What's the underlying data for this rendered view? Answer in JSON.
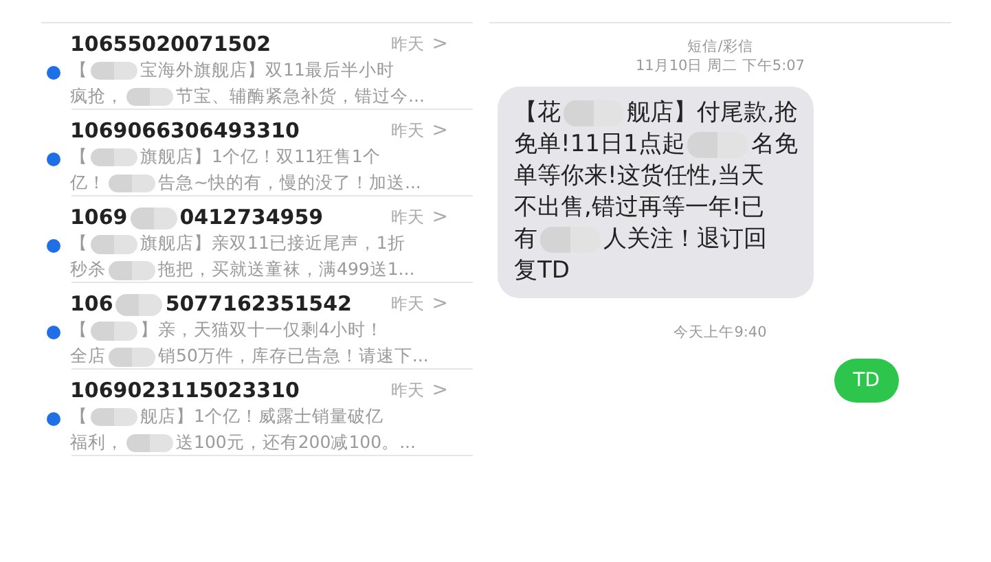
{
  "message_list": [
    {
      "sender": [
        "10655020071502"
      ],
      "time": "昨天",
      "chevron": ">",
      "unread": true,
      "preview": [
        [
          "【",
          "宝海外旗舰店】双11最后半小时"
        ],
        [
          "疯抢，",
          "节宝、辅酶紧急补货，错过今..."
        ]
      ]
    },
    {
      "sender": [
        "1069066306493310"
      ],
      "time": "昨天",
      "chevron": ">",
      "unread": true,
      "preview": [
        [
          "【",
          "旗舰店】1个亿！双11狂售1个"
        ],
        [
          "亿！",
          "告急~快的有，慢的没了！加送..."
        ]
      ]
    },
    {
      "sender": [
        "1069",
        "0412734959"
      ],
      "time": "昨天",
      "chevron": ">",
      "unread": true,
      "preview": [
        [
          "【",
          "旗舰店】亲双11已接近尾声，1折"
        ],
        [
          "秒杀",
          "拖把，买就送童袜，满499送1..."
        ]
      ]
    },
    {
      "sender": [
        "106",
        "5077162351542"
      ],
      "time": "昨天",
      "chevron": ">",
      "unread": true,
      "preview": [
        [
          "【",
          "】亲，天猫双十一仅剩4小时！"
        ],
        [
          "全店",
          "销50万件，库存已告急！请速下..."
        ]
      ]
    },
    {
      "sender": [
        "1069023115023310"
      ],
      "time": "昨天",
      "chevron": ">",
      "unread": true,
      "preview": [
        [
          "【",
          "舰店】1个亿！威露士销量破亿"
        ],
        [
          "福利，",
          "送100元，还有200减100。..."
        ]
      ]
    }
  ],
  "conversation": {
    "service": "短信/彩信",
    "date": "11月10日 周二 下午5:07",
    "messages": [
      {
        "kind": "received",
        "lines": [
          [
            "【花",
            "舰店】付尾款,抢"
          ],
          [
            "免单!11日1点起",
            "名免"
          ],
          [
            "单等你来!这货任性,当天"
          ],
          [
            "不出售,错过再等一年!已"
          ],
          [
            "有",
            "人关注！退订回"
          ],
          [
            "复TD"
          ]
        ]
      },
      {
        "kind": "time",
        "text": "今天上午9:40"
      },
      {
        "kind": "sent",
        "lines": [
          [
            "TD"
          ]
        ]
      }
    ]
  }
}
